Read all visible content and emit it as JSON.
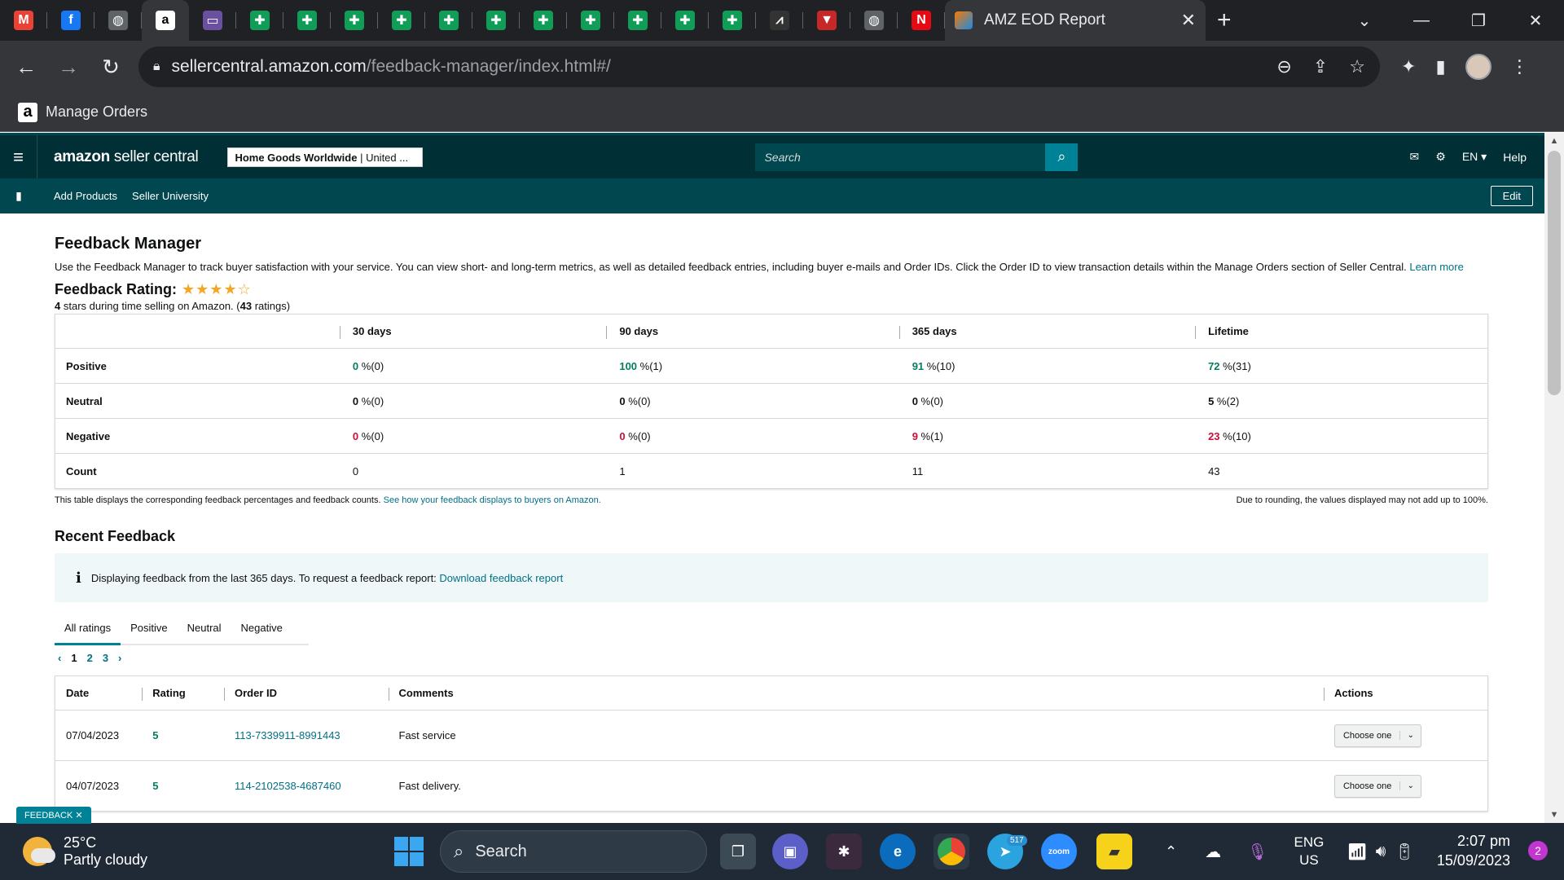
{
  "browser": {
    "tabs_pinned": [
      {
        "icon": "gmail-icon",
        "glyph": "M",
        "color": "#ea4335"
      },
      {
        "icon": "facebook-icon",
        "glyph": "f",
        "color": "#1877f2"
      },
      {
        "icon": "globe-icon",
        "glyph": "◍",
        "color": "#5f6368"
      },
      {
        "icon": "amazon-icon",
        "glyph": "a",
        "color": "#000000"
      },
      {
        "icon": "flag-icon",
        "glyph": "▭",
        "color": "#6b4fa0"
      },
      {
        "icon": "sheets-icon",
        "glyph": "✚",
        "color": "#0f9d58"
      },
      {
        "icon": "sheets-icon",
        "glyph": "✚",
        "color": "#0f9d58"
      },
      {
        "icon": "sheets-icon",
        "glyph": "✚",
        "color": "#0f9d58"
      },
      {
        "icon": "sheets-icon",
        "glyph": "✚",
        "color": "#0f9d58"
      },
      {
        "icon": "sheets-icon",
        "glyph": "✚",
        "color": "#0f9d58"
      },
      {
        "icon": "sheets-icon",
        "glyph": "✚",
        "color": "#0f9d58"
      },
      {
        "icon": "sheets-icon",
        "glyph": "✚",
        "color": "#0f9d58"
      },
      {
        "icon": "sheets-icon",
        "glyph": "✚",
        "color": "#0f9d58"
      },
      {
        "icon": "sheets-icon",
        "glyph": "✚",
        "color": "#0f9d58"
      },
      {
        "icon": "sheets-icon",
        "glyph": "✚",
        "color": "#0f9d58"
      },
      {
        "icon": "sheets-icon",
        "glyph": "✚",
        "color": "#0f9d58"
      },
      {
        "icon": "chart-icon",
        "glyph": "⩘",
        "color": "#333333"
      },
      {
        "icon": "shield-icon",
        "glyph": "▼",
        "color": "#c62828"
      },
      {
        "icon": "globe-icon",
        "glyph": "◍",
        "color": "#5f6368"
      },
      {
        "icon": "netflix-icon",
        "glyph": "N",
        "color": "#e50914"
      }
    ],
    "active_tab_title": "AMZ EOD Report",
    "url_domain": "sellercentral.amazon.com",
    "url_path": "/feedback-manager/index.html#/",
    "bookmark_label": "Manage Orders"
  },
  "header": {
    "logo_bold": "amazon",
    "logo_rest": " seller central",
    "store_name": "Home Goods Worldwide",
    "store_region": "United ...",
    "search_placeholder": "Search",
    "language": "EN ▾",
    "help": "Help",
    "nav_links": [
      "Add Products",
      "Seller University"
    ],
    "edit": "Edit"
  },
  "page": {
    "title": "Feedback Manager",
    "intro": "Use the Feedback Manager to track buyer satisfaction with your service. You can view short- and long-term metrics, as well as detailed feedback entries, including buyer e-mails and Order IDs. Click the Order ID to view transaction details within the Manage Orders section of Seller Central.",
    "learn_more": "Learn more",
    "rating_title": "Feedback Rating:",
    "stars": "★★★★☆",
    "rating_stars_value": "4",
    "rating_sub_mid": " stars during time selling on Amazon. (",
    "rating_count": "43",
    "rating_sub_end": " ratings)"
  },
  "metrics": {
    "columns": [
      "30 days",
      "90 days",
      "365 days",
      "Lifetime"
    ],
    "rows": [
      {
        "label": "Positive",
        "cells": [
          [
            "0",
            " %(0)",
            "g"
          ],
          [
            "100",
            " %(1)",
            "g"
          ],
          [
            "91",
            " %(10)",
            "g"
          ],
          [
            "72",
            " %(31)",
            "g"
          ]
        ]
      },
      {
        "label": "Neutral",
        "cells": [
          [
            "0",
            " %(0)",
            "k"
          ],
          [
            "0",
            " %(0)",
            "k"
          ],
          [
            "0",
            " %(0)",
            "k"
          ],
          [
            "5",
            " %(2)",
            "k"
          ]
        ]
      },
      {
        "label": "Negative",
        "cells": [
          [
            "0",
            " %(0)",
            "r"
          ],
          [
            "0",
            " %(0)",
            "r"
          ],
          [
            "9",
            " %(1)",
            "r"
          ],
          [
            "23",
            " %(10)",
            "r"
          ]
        ]
      },
      {
        "label": "Count",
        "cells": [
          [
            "",
            "0",
            "k"
          ],
          [
            "",
            "1",
            "k"
          ],
          [
            "",
            "11",
            "k"
          ],
          [
            "",
            "43",
            "k"
          ]
        ]
      }
    ],
    "foot_left": "This table displays the corresponding feedback percentages and feedback counts.",
    "foot_link": "See how your feedback displays to buyers on Amazon.",
    "foot_right": "Due to rounding, the values displayed may not add up to 100%."
  },
  "recent": {
    "title": "Recent Feedback",
    "info_text": "Displaying feedback from the last 365 days. To request a feedback report:",
    "info_link": "Download feedback report",
    "tabs": [
      "All ratings",
      "Positive",
      "Neutral",
      "Negative"
    ],
    "pages": [
      "1",
      "2",
      "3"
    ],
    "columns": [
      "Date",
      "Rating",
      "Order ID",
      "Comments",
      "Actions"
    ],
    "rows": [
      {
        "date": "07/04/2023",
        "rating": "5",
        "order": "113-7339911-8991443",
        "comment": "Fast service",
        "action": "Choose one"
      },
      {
        "date": "04/07/2023",
        "rating": "5",
        "order": "114-2102538-4687460",
        "comment": "Fast delivery.",
        "action": "Choose one"
      }
    ],
    "feedback_tab": "FEEDBACK ✕"
  },
  "taskbar": {
    "temp": "25°C",
    "weather": "Partly cloudy",
    "search": "Search",
    "telegram_badge": "517",
    "lang1": "ENG",
    "lang2": "US",
    "time": "2:07 pm",
    "date": "15/09/2023",
    "notifications": "2"
  }
}
